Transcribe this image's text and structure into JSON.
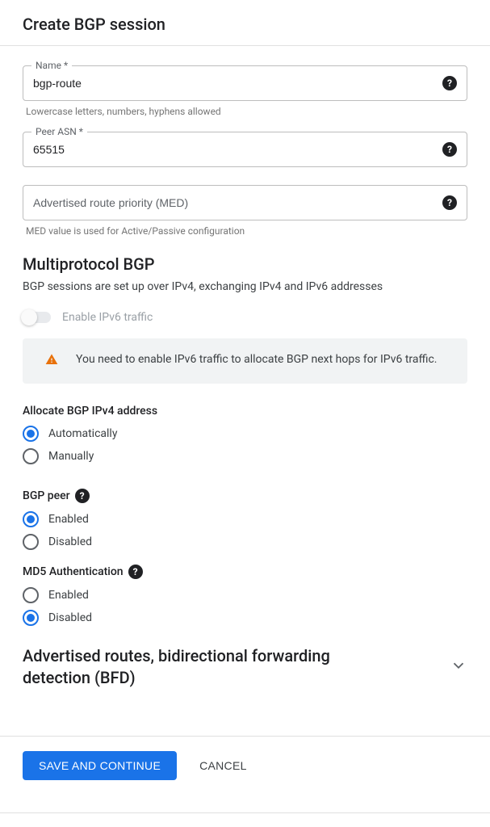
{
  "header": {
    "title": "Create BGP session"
  },
  "fields": {
    "name": {
      "label": "Name *",
      "value": "bgp-route",
      "helper": "Lowercase letters, numbers, hyphens allowed"
    },
    "asn": {
      "label": "Peer ASN *",
      "value": "65515"
    },
    "med": {
      "placeholder": "Advertised route priority (MED)",
      "helper": "MED value is used for Active/Passive configuration"
    }
  },
  "multiprotocol": {
    "title": "Multiprotocol BGP",
    "desc": "BGP sessions are set up over IPv4, exchanging IPv4 and IPv6 addresses",
    "toggle_label": "Enable IPv6 traffic",
    "alert": "You need to enable IPv6 traffic to allocate BGP next hops for IPv6 traffic."
  },
  "allocate": {
    "label": "Allocate BGP IPv4 address",
    "options": {
      "auto": "Automatically",
      "manual": "Manually"
    }
  },
  "bgp_peer": {
    "label": "BGP peer",
    "options": {
      "enabled": "Enabled",
      "disabled": "Disabled"
    }
  },
  "md5": {
    "label": "MD5 Authentication",
    "options": {
      "enabled": "Enabled",
      "disabled": "Disabled"
    }
  },
  "expander": {
    "title": "Advertised routes, bidirectional forwarding detection (BFD)"
  },
  "footer": {
    "save": "SAVE AND CONTINUE",
    "cancel": "CANCEL"
  }
}
